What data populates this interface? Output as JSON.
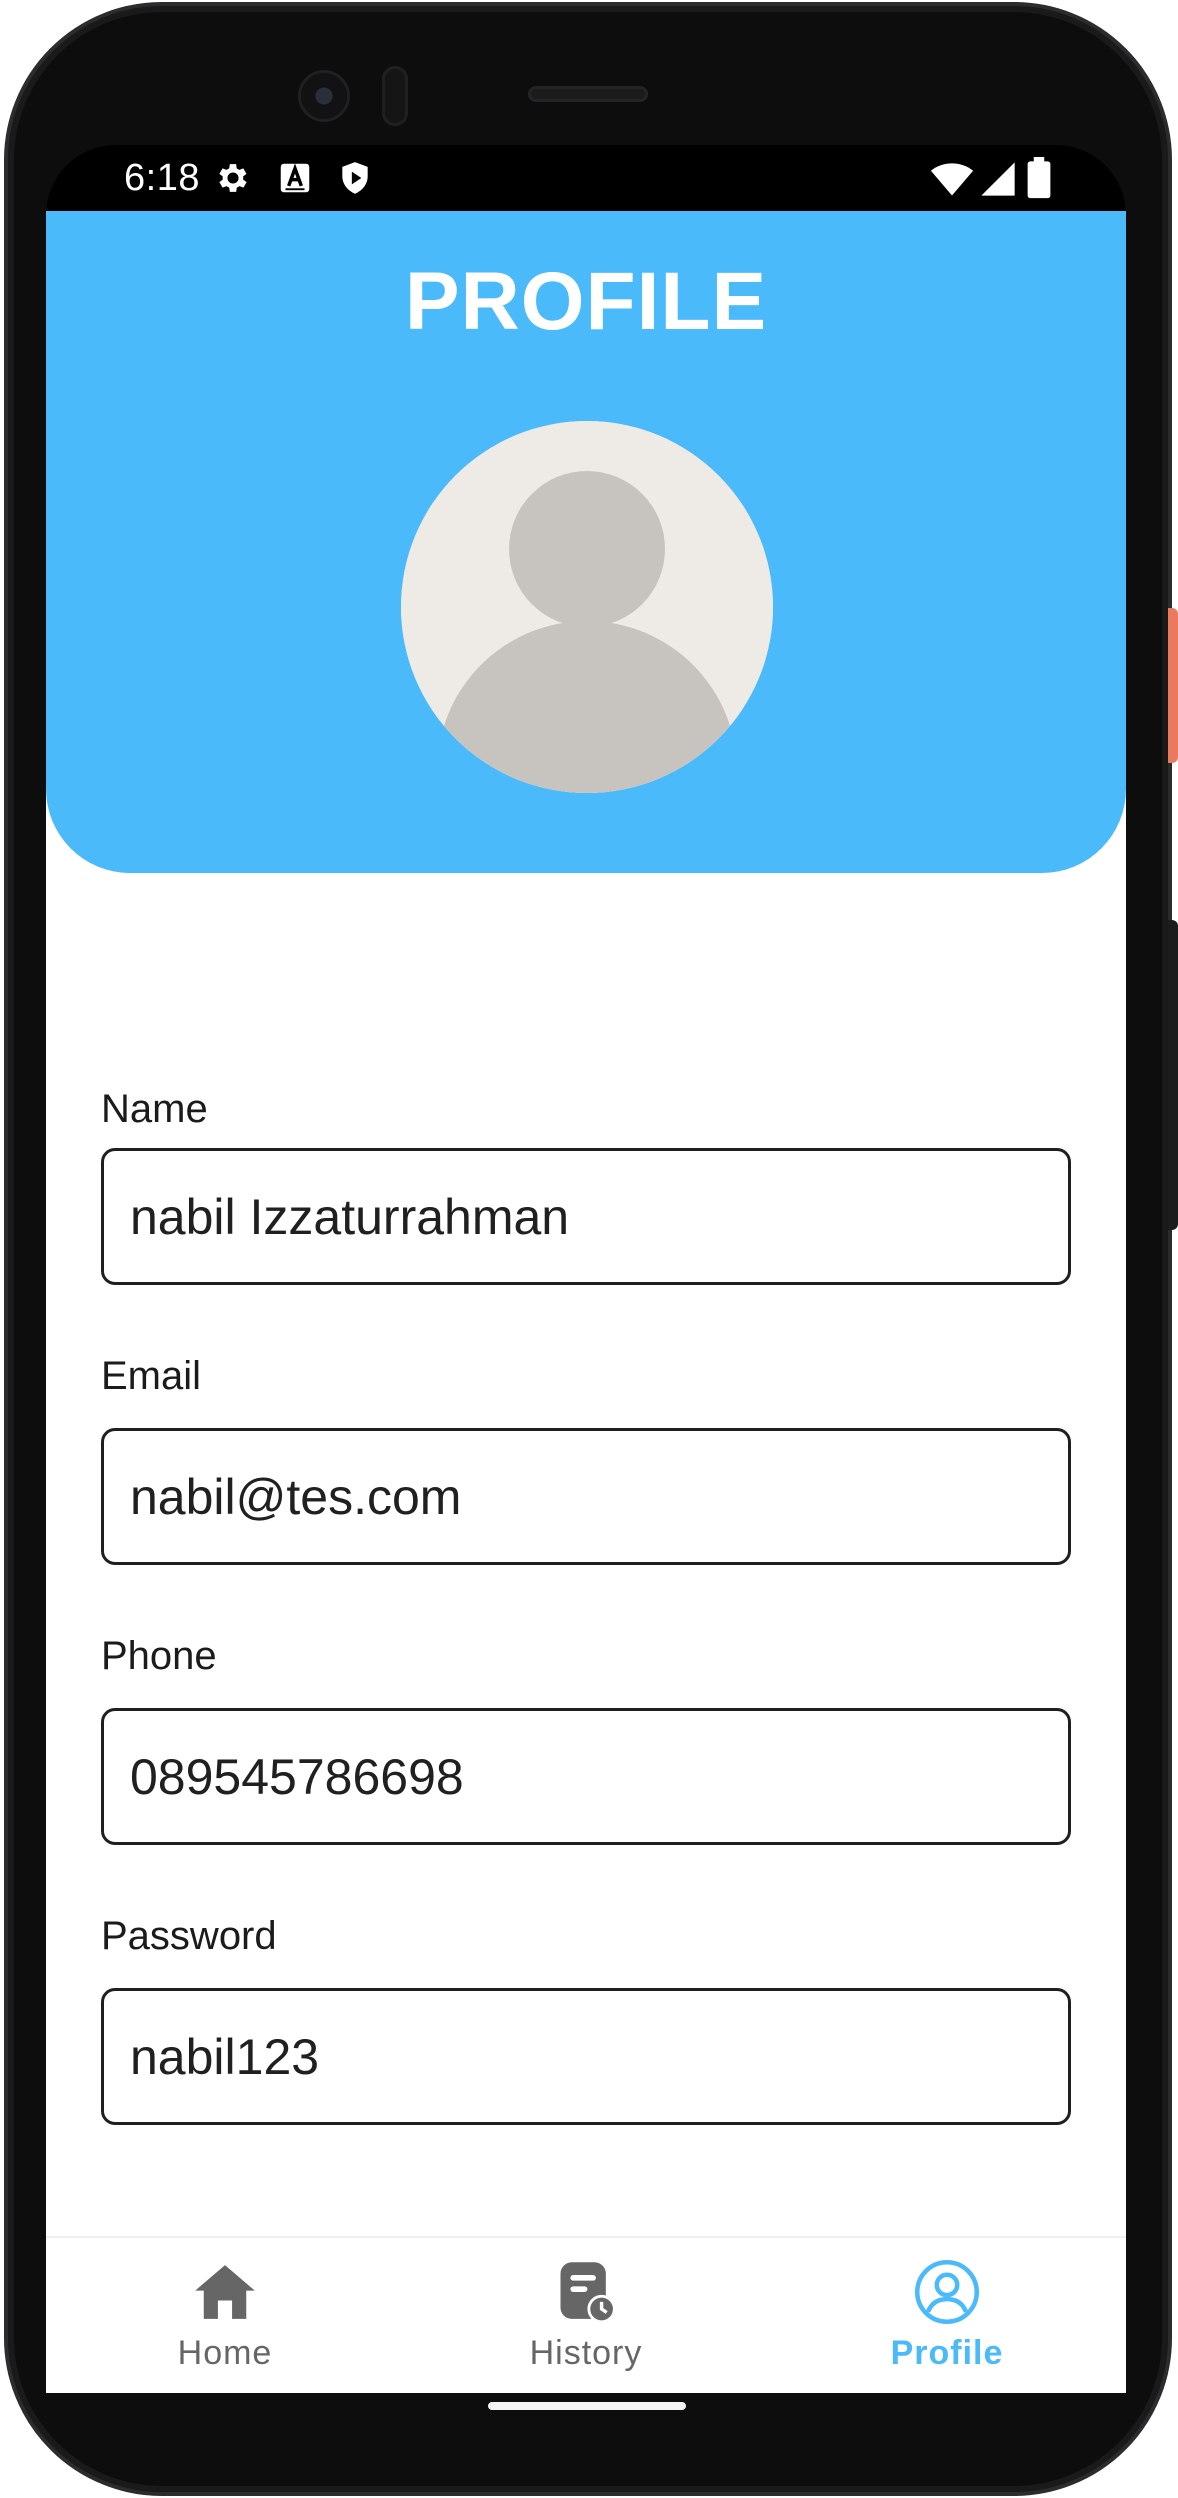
{
  "status_bar": {
    "time": "6:18",
    "left_icons": [
      "gear-icon",
      "font-a-icon",
      "shield-play-icon"
    ],
    "right_icons": [
      "wifi-icon",
      "cellular-signal-icon",
      "battery-icon"
    ]
  },
  "header": {
    "title": "PROFILE",
    "background_color": "#4bbafb"
  },
  "form": {
    "name": {
      "label": "Name",
      "value": "nabil Izzaturrahman"
    },
    "email": {
      "label": "Email",
      "value": "nabil@tes.com"
    },
    "phone": {
      "label": "Phone",
      "value": "089545786698"
    },
    "password": {
      "label": "Password",
      "value": "nabil123"
    }
  },
  "bottom_nav": {
    "items": [
      {
        "label": "Home",
        "icon": "home-icon",
        "active": false
      },
      {
        "label": "History",
        "icon": "history-icon",
        "active": false
      },
      {
        "label": "Profile",
        "icon": "profile-icon",
        "active": true
      }
    ],
    "active_color": "#4bbafb",
    "inactive_color": "#666666"
  }
}
